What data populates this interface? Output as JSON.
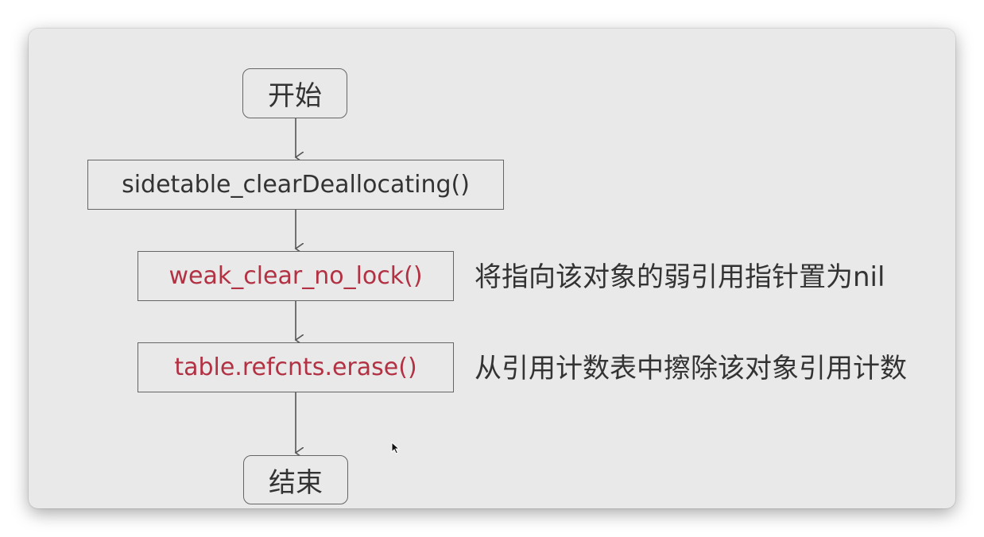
{
  "diagram": {
    "start": "开始",
    "step_1": "sidetable_clearDeallocating()",
    "step_2": "weak_clear_no_lock()",
    "step_3": "table.refcnts.erase()",
    "end": "结束",
    "note_step_2": "将指向该对象的弱引用指针置为nil",
    "note_step_3": "从引用计数表中擦除该对象引用计数"
  },
  "colors": {
    "background": "#e9e9e9",
    "border": "#666666",
    "text": "#333333",
    "highlight_text": "#b23143"
  }
}
